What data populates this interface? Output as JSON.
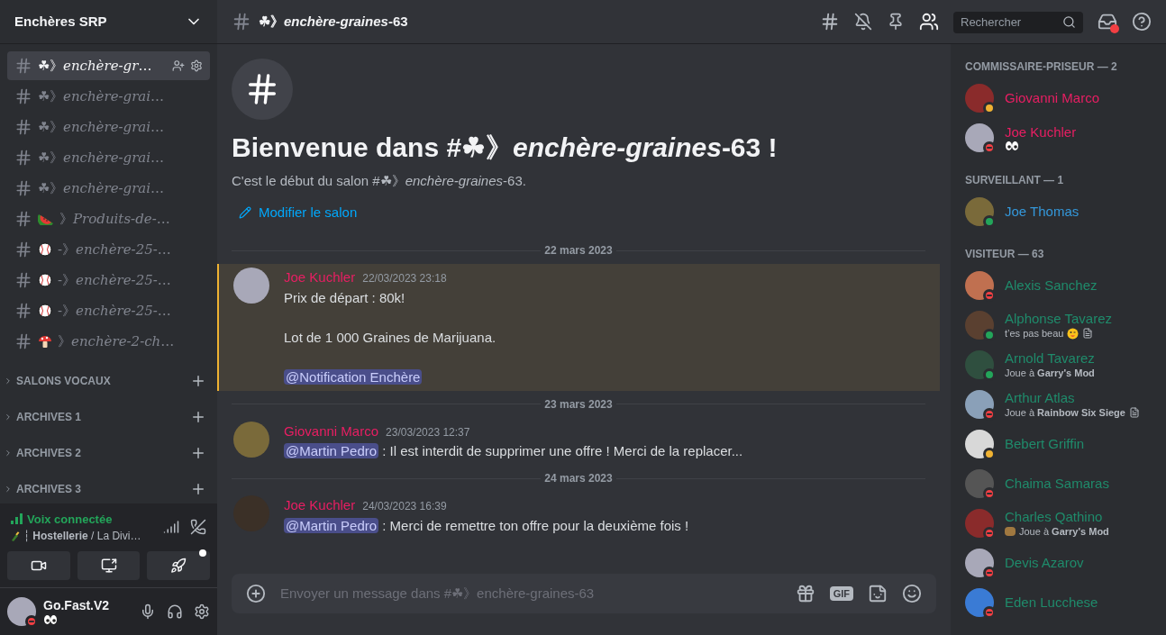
{
  "server": {
    "name": "Enchères SRP"
  },
  "channels": [
    {
      "kind": "plain",
      "name": "☘》*enchère-gr*…",
      "selected": true
    },
    {
      "kind": "plain",
      "name": "☘》*enchère-grai*…",
      "selected": false
    },
    {
      "kind": "plain",
      "name": "☘》*enchère-grai*…",
      "selected": false
    },
    {
      "kind": "plain",
      "name": "☘》*enchère-grai*…",
      "selected": false
    },
    {
      "kind": "plain",
      "name": "☘》*enchère-grai*…",
      "selected": false
    },
    {
      "kind": "watermelon",
      "name": "》*Produits-de-*…",
      "selected": false
    },
    {
      "kind": "baseball",
      "name": "-》*enchère-25-*…",
      "selected": false
    },
    {
      "kind": "baseball",
      "name": "-》*enchère-25-*…",
      "selected": false
    },
    {
      "kind": "baseball",
      "name": "-》*enchère-25-*…",
      "selected": false
    },
    {
      "kind": "mushroom",
      "name": "》*enchère-2-ch*…",
      "selected": false
    }
  ],
  "categories": [
    {
      "label": "SALONS VOCAUX",
      "expanded": false
    },
    {
      "label": "ARCHIVES 1",
      "expanded": false
    },
    {
      "label": "ARCHIVES 2",
      "expanded": false
    },
    {
      "label": "ARCHIVES 3",
      "expanded": false
    }
  ],
  "voice": {
    "status": "Voix connectée",
    "channel": "┆ **Hostellerie** / La Divi…"
  },
  "user": {
    "name": "Go.Fast.V2",
    "kind": "dnd"
  },
  "header": {
    "channel": "☘》*enchère-graines*-63",
    "search": {
      "placeholder": "Rechercher"
    }
  },
  "welcome": {
    "title": "Bienvenue dans #☘》*enchère-graines*-63 !",
    "subtitle": "C'est le début du salon #☘》*enchère-graines*-63.",
    "edit_link": "Modifier le salon"
  },
  "messages": [
    {
      "kind": "divider",
      "label": "22 mars 2023"
    },
    {
      "kind": "message",
      "author": "Joe Kuchler",
      "color": "#e91e63",
      "time": "22/03/2023 23:18",
      "highlighted": true,
      "paragraphs": [
        [
          {
            "kind": "text",
            "text": "Prix de départ : 80k!"
          }
        ],
        [
          {
            "kind": "text",
            "text": "Lot de 1 000 Graines de Marijuana."
          }
        ],
        [
          {
            "kind": "mention",
            "text": "@Notification Enchère"
          }
        ]
      ]
    },
    {
      "kind": "divider",
      "label": "23 mars 2023"
    },
    {
      "kind": "message",
      "author": "Giovanni Marco",
      "color": "#e91e63",
      "time": "23/03/2023 12:37",
      "highlighted": false,
      "paragraphs": [
        [
          {
            "kind": "mention",
            "text": "@Martin Pedro"
          },
          {
            "kind": "text",
            "text": " : Il est interdit de supprimer une offre ! Merci de la replacer..."
          }
        ]
      ]
    },
    {
      "kind": "divider",
      "label": "24 mars 2023"
    },
    {
      "kind": "message",
      "author": "Joe Kuchler",
      "color": "#e91e63",
      "time": "24/03/2023 16:39",
      "highlighted": false,
      "paragraphs": [
        [
          {
            "kind": "mention",
            "text": "@Martin Pedro"
          },
          {
            "kind": "text",
            "text": " : Merci de remettre ton offre pour la deuxième fois !"
          }
        ]
      ]
    }
  ],
  "composer": {
    "placeholder": "Envoyer un message dans #☘》enchère-graines-63",
    "gif": "GIF"
  },
  "member_groups": [
    {
      "title": "COMMISSAIRE-PRISEUR — 2",
      "color": "#e91e63",
      "members": [
        {
          "name": "Giovanni Marco",
          "kind": "idle"
        },
        {
          "name": "Joe Kuchler",
          "kind": "dnd",
          "eyes": true
        }
      ]
    },
    {
      "title": "SURVEILLANT — 1",
      "color": "#3498db",
      "members": [
        {
          "name": "Joe Thomas",
          "kind": "online"
        }
      ]
    },
    {
      "title": "VISITEUR — 63",
      "color": "#1f8b6b",
      "members": [
        {
          "name": "Alexis Sanchez",
          "kind": "dnd"
        },
        {
          "name": "Alphonse Tavarez",
          "kind": "online",
          "activity": "t’es pas beau",
          "emoji": true,
          "note": true
        },
        {
          "name": "Arnold Tavarez",
          "kind": "online",
          "activity": "Joue à **Garry's Mod**"
        },
        {
          "name": "Arthur Atlas",
          "kind": "dnd",
          "activity": "Joue à **Rainbow Six Siege**",
          "note": true
        },
        {
          "name": "Bebert Griffin",
          "kind": "idle"
        },
        {
          "name": "Chaima Samaras",
          "kind": "dnd"
        },
        {
          "name": "Charles Qathino",
          "kind": "dnd",
          "activity": "Joue à **Garry's Mod**",
          "game_icon": true
        },
        {
          "name": "Devis Azarov",
          "kind": "dnd"
        },
        {
          "name": "Eden Lucchese",
          "kind": "dnd"
        }
      ]
    }
  ]
}
